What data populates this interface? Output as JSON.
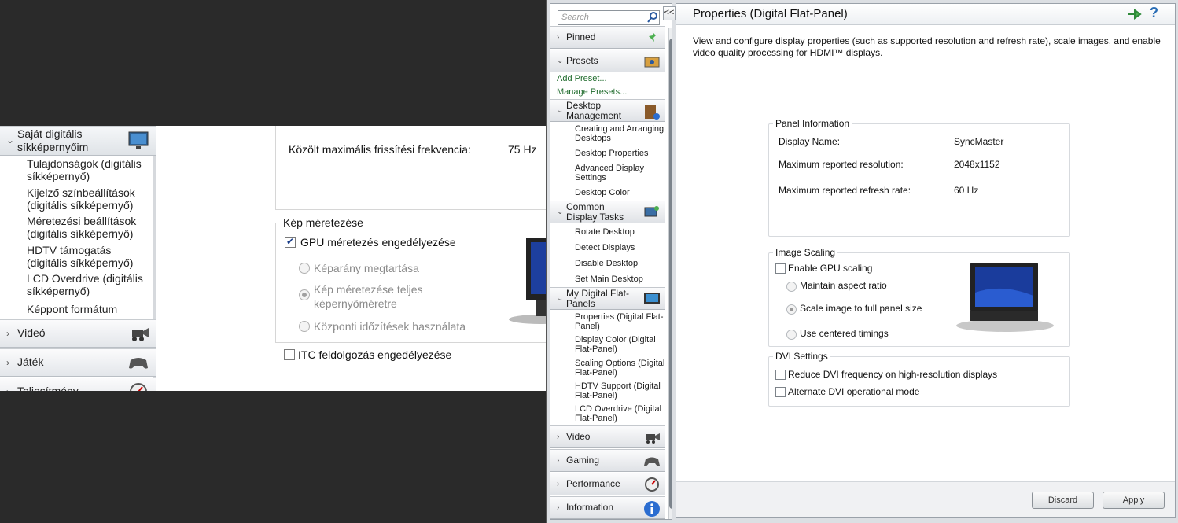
{
  "hu": {
    "nav": {
      "own_section": "Saját digitális síkképernyőim",
      "items": [
        "Tulajdonságok (digitális síkképernyő)",
        "Kijelző színbeállítások (digitális síkképernyő)",
        "Méretezési beállítások (digitális síkképernyő)",
        "HDTV támogatás (digitális síkképernyő)",
        "LCD Overdrive (digitális síkképernyő)",
        "Képpont formátum"
      ],
      "video": "Videó",
      "gaming": "Játék",
      "performance": "Teljesítmény"
    },
    "refresh_label": "Közölt maximális frissítési frekvencia:",
    "refresh_value": "75 Hz",
    "scaling_legend": "Kép méretezése",
    "gpu_scaling": "GPU méretezés engedélyezése",
    "gpu_scaling_checked": true,
    "radio_aspect": "Képarány megtartása",
    "radio_full": "Kép méretezése teljes képernyőméretre",
    "radio_centered": "Központi időzítések használata",
    "itc": "ITC feldolgozás engedélyezése",
    "itc_checked": false
  },
  "nv": {
    "search_placeholder": "Search",
    "collapse_label": "<<",
    "sections": {
      "pinned": "Pinned",
      "presets": "Presets",
      "desktop_management": "Desktop Management",
      "common_tasks": "Common Display Tasks",
      "my_panels": "My Digital Flat-Panels",
      "video": "Video",
      "gaming": "Gaming",
      "performance": "Performance",
      "information": "Information"
    },
    "preset_links": [
      "Add Preset...",
      "Manage Presets..."
    ],
    "desktop_tasks": [
      "Creating and Arranging Desktops",
      "Desktop Properties",
      "Advanced Display Settings",
      "Desktop Color"
    ],
    "common_tasks": [
      "Rotate Desktop",
      "Detect Displays",
      "Disable Desktop",
      "Set Main Desktop"
    ],
    "panel_tasks": [
      "Properties (Digital Flat-Panel)",
      "Display Color (Digital Flat-Panel)",
      "Scaling Options (Digital Flat-Panel)",
      "HDTV Support (Digital Flat-Panel)",
      "LCD Overdrive (Digital Flat-Panel)"
    ],
    "page_title": "Properties (Digital Flat-Panel)",
    "help_label": "?",
    "description": "View and configure display properties (such as supported resolution and refresh rate), scale images, and enable video quality processing for HDMI™ displays.",
    "panel_info": {
      "legend": "Panel Information",
      "display_name_label": "Display Name:",
      "display_name": "SyncMaster",
      "max_res_label": "Maximum reported resolution:",
      "max_res": "2048x1152",
      "max_refresh_label": "Maximum reported refresh rate:",
      "max_refresh": "60 Hz"
    },
    "image_scaling": {
      "legend": "Image Scaling",
      "enable_gpu": "Enable GPU scaling",
      "enable_gpu_checked": false,
      "maintain_aspect": "Maintain aspect ratio",
      "full_panel": "Scale image to full panel size",
      "centered": "Use centered timings",
      "selected": "full_panel"
    },
    "dvi": {
      "legend": "DVI Settings",
      "reduce": "Reduce DVI frequency on high-resolution displays",
      "alternate": "Alternate DVI operational mode"
    },
    "buttons": {
      "discard": "Discard",
      "apply": "Apply"
    }
  },
  "colors": {
    "link": "#1f6b2c",
    "help": "#2a6db5",
    "scrollbar": "#7c848c"
  }
}
